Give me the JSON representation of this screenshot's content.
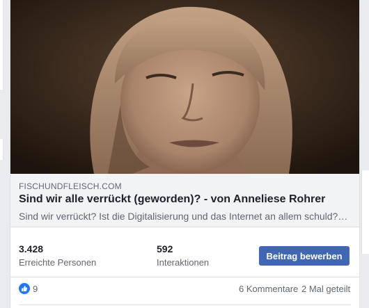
{
  "post": {
    "image_alt": "Portrait photo",
    "link": {
      "domain": "FISCHUNDFLEISCH.COM",
      "title": "Sind wir alle verrückt (geworden)? - von Anneliese Rohrer",
      "description": "Sind wir verrückt? Ist die Digitalisierung und das Internet an allem schuld? Ja, ja!"
    },
    "stats": {
      "reach_value": "3.428",
      "reach_label": "Erreichte Personen",
      "engagement_value": "592",
      "engagement_label": "Interaktionen",
      "promote_label": "Beitrag bewerben"
    },
    "reactions": {
      "like_icon": "thumbs-up-icon",
      "like_count": "9",
      "comments": "6 Kommentare",
      "shares": "2 Mal geteilt"
    }
  },
  "colors": {
    "accent": "#4267b2",
    "like_blue": "#2078f4",
    "link_bg": "#f2f3f5"
  }
}
